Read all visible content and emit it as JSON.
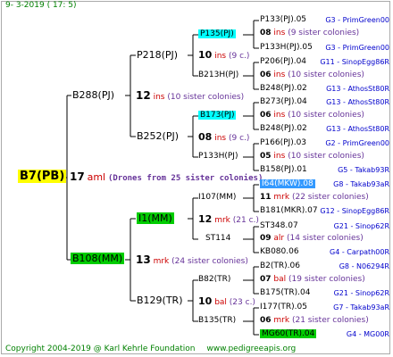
{
  "date": "9-  3-2019 (  17:   5)",
  "footer": {
    "copyright": "Copyright 2004-2019 @ Karl Kehrle Foundation",
    "site": "www.pedigreeapis.org"
  },
  "root": {
    "label": "B7(PB)",
    "num": "17",
    "code": "aml",
    "desc": "(Drones from 25 sister colonies)"
  },
  "gen1": [
    {
      "label": "B288(PJ)",
      "num": "12",
      "code": "ins",
      "desc": "(10 sister colonies)"
    },
    {
      "label": "B108(MM)",
      "num": "13",
      "code": "mrk",
      "desc": "(24 sister colonies)"
    }
  ],
  "gen2": [
    {
      "label": "P218(PJ)",
      "num": "",
      "code": "",
      "desc": ""
    },
    {
      "label": "B252(PJ)",
      "num": "08",
      "code": "ins",
      "desc": "(9 c.)"
    },
    {
      "label": "I1(MM)",
      "num": "12",
      "code": "mrk",
      "desc": "(21 c.)"
    },
    {
      "label": "B129(TR)",
      "num": "",
      "code": "",
      "desc": ""
    }
  ],
  "gen3": [
    {
      "label": "P135(PJ)",
      "num": "10",
      "code": "ins",
      "desc": "(9 c.)"
    },
    {
      "label": "B213H(PJ)",
      "num": "",
      "code": "",
      "desc": ""
    },
    {
      "label": "B173(PJ)",
      "num": "",
      "code": "",
      "desc": ""
    },
    {
      "label": "P133H(PJ)",
      "num": "",
      "code": "",
      "desc": ""
    },
    {
      "label": "I107(MM)",
      "num": "",
      "code": "",
      "desc": ""
    },
    {
      "label": "ST114",
      "num": "",
      "code": "",
      "desc": ""
    },
    {
      "label": "B82(TR)",
      "num": "10",
      "code": "bal",
      "desc": "(23 c.)"
    },
    {
      "label": "B135(TR)",
      "num": "",
      "code": "",
      "desc": ""
    }
  ],
  "gen4": [
    {
      "a": "P133(PJ).05",
      "b": "G3 - PrimGreen00"
    },
    {
      "num": "08",
      "code": "ins",
      "desc": "(9 sister colonies)"
    },
    {
      "a": "P133H(PJ).05",
      "b": "G3 - PrimGreen00"
    },
    {
      "a": "P206(PJ).04",
      "b": "G11 - SinopEgg86R"
    },
    {
      "num": "06",
      "code": "ins",
      "desc": "(10 sister colonies)"
    },
    {
      "a": "B248(PJ).02",
      "b": "G13 - AthosSt80R"
    },
    {
      "a": "B273(PJ).04",
      "b": "G13 - AthosSt80R"
    },
    {
      "num": "06",
      "code": "ins",
      "desc": "(10 sister colonies)"
    },
    {
      "a": "B248(PJ).02",
      "b": "G13 - AthosSt80R"
    },
    {
      "a": "P166(PJ).03",
      "b": "G2 - PrimGreen00"
    },
    {
      "num": "05",
      "code": "ins",
      "desc": "(10 sister colonies)"
    },
    {
      "a": "B158(PJ).01",
      "b": "G5 - Takab93R"
    },
    {
      "a": "I64(MKW).08",
      "b": "G8 - Takab93aR"
    },
    {
      "num": "11",
      "code": "mrk",
      "desc": "(22 sister colonies)"
    },
    {
      "a": "B181(MKR).07",
      "b": "G12 - SinopEgg86R"
    },
    {
      "a": "ST348.07",
      "b": "G21 - Sinop62R"
    },
    {
      "num": "09",
      "code": "alr",
      "desc": "(14 sister colonies)"
    },
    {
      "a": "KB080.06",
      "b": "G4 - Carpath00R"
    },
    {
      "a": "B2(TR).06",
      "b": "G8 - N06294R"
    },
    {
      "num": "07",
      "code": "bal",
      "desc": "(19 sister colonies)"
    },
    {
      "a": "B175(TR).04",
      "b": "G21 - Sinop62R"
    },
    {
      "a": "I177(TR).05",
      "b": "G7 - Takab93aR"
    },
    {
      "num": "06",
      "code": "mrk",
      "desc": "(21 sister colonies)"
    },
    {
      "a": "MG60(TR).04",
      "b": "G4 - MG00R"
    }
  ],
  "colors": {
    "line": "#000000",
    "yellow": "#ffff00",
    "green": "#00cc00",
    "cyan": "#00ffff",
    "blue": "#3399ff"
  }
}
